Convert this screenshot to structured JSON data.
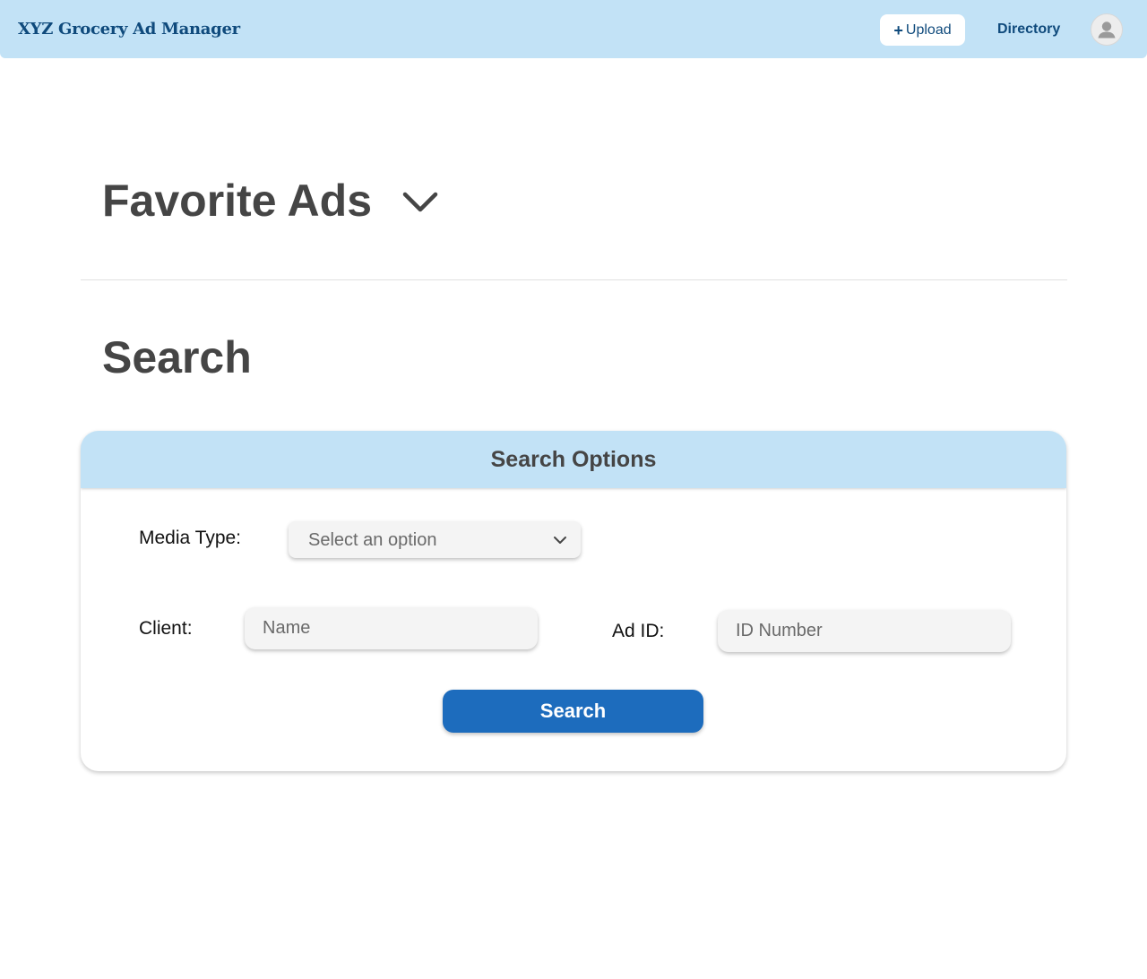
{
  "header": {
    "brand": "XYZ Grocery Ad Manager",
    "upload_label": "Upload",
    "upload_icon": "plus-icon",
    "directory_label": "Directory",
    "avatar_icon": "user-icon",
    "background_color": "#c2e2f6",
    "text_color": "#0f4a7c"
  },
  "favorites": {
    "title": "Favorite Ads",
    "toggle_icon": "chevron-down-icon"
  },
  "search": {
    "title": "Search",
    "card_title": "Search Options",
    "media_type": {
      "label": "Media Type:",
      "value": "Select an option",
      "icon": "chevron-down-icon"
    },
    "client": {
      "label": "Client:",
      "placeholder": "Name"
    },
    "ad_id": {
      "label": "Ad ID:",
      "placeholder": "ID Number"
    },
    "submit_label": "Search",
    "button_color": "#1d6cbd"
  }
}
